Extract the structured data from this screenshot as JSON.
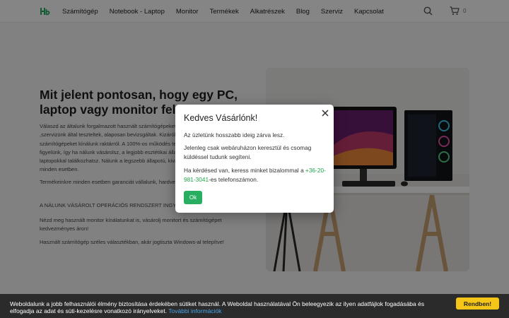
{
  "nav": {
    "items": [
      "Számítógép",
      "Notebook - Laptop",
      "Monitor",
      "Termékek",
      "Alkatrészek",
      "Blog",
      "Szerviz",
      "Kapcsolat"
    ],
    "cart_count": "0"
  },
  "main": {
    "title": "Mit jelent pontosan, hogy egy PC, laptop vagy monitor felújított?",
    "p1": "Válaszd az általunk forgalmazott használt számítógépeket, hiszen ezek minden esetben ,szervizünk által teszteltek, alaposan bevizsgáltak. Kizárólag hibátlanul működő, tesztelt számítógépeket kínálunk raktárról. A 100%-os működés természetes. Mi a külcsinre is figyelünk, így ha nálunk vásárolsz, a legjobb esztétikai állapotú számítógépekkel és laptopokkal találkozhatsz. Nálunk a legszebb állapotú, kiválogatott gépeket árusítja minden esetben.",
    "p2": "Termékeinkre minden esetben garanciát vállalunk, hardveres garanciával!",
    "p3": "A NÁLUNK VÁSÁROLT OPERÁCIÓS RENDSZERT INGYEN TELEPÍTJÜK!",
    "p4": "Nézd meg használt monitor kínálatunkat is, vásárolj monitort és számítógépet kedvezményes áron!",
    "p5": "Használt számítógép széles választékban, akár jogtiszta Windows-al telepítve!"
  },
  "modal": {
    "title": "Kedves Vásárlónk!",
    "line1": "Az üzletünk hosszabb ideig zárva lesz.",
    "line2": "Jelenleg csak webáruházon keresztül és csomag küldéssel tudunk segíteni.",
    "line3_pre": "Ha kérdésed van, keress minket bizalommal a ",
    "phone": "+36-20-981-3041",
    "line3_post": "-es telefonszámon.",
    "ok_label": "Ok"
  },
  "cookie": {
    "text": "Weboldalunk a jobb felhasználói élmény biztosítása érdekében sütiket használ. A Weboldal használatával Ön beleegyezik az ilyen adatfájlok fogadásába és elfogadja az adat és süti-kezelésre vonatkozó irányelveket.",
    "link": "További információk",
    "button": "Rendben!"
  },
  "colors": {
    "accent": "#27ae60",
    "cookie_button": "#f5c518",
    "cookie_bg": "#2b2b2b"
  },
  "icons": [
    "logo-icon",
    "search-icon",
    "cart-icon",
    "close-icon"
  ]
}
